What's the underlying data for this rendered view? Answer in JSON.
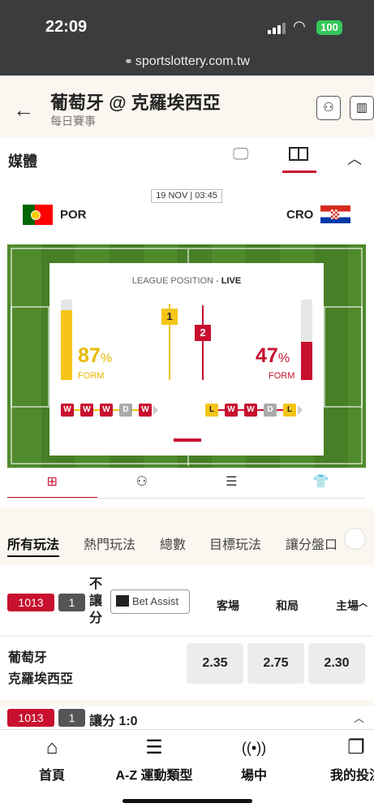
{
  "status": {
    "time": "22:09",
    "battery": "100"
  },
  "browser": {
    "url": "sportslottery.com.tw"
  },
  "header": {
    "title": "葡萄牙 @ 克羅埃西亞",
    "subtitle": "每日賽事"
  },
  "media": {
    "label": "媒體"
  },
  "match": {
    "datetime": "19 NOV | 03:45",
    "home": {
      "code": "POR"
    },
    "away": {
      "code": "CRO"
    }
  },
  "stats": {
    "league_position_label": "LEAGUE POSITION - ",
    "live_label": "LIVE",
    "home": {
      "form_pct": "87",
      "form_value": 0.87,
      "position": "1",
      "color": "#f5c518",
      "form": [
        "W",
        "W",
        "W",
        "D",
        "W"
      ]
    },
    "away": {
      "form_pct": "47",
      "form_value": 0.47,
      "position": "2",
      "color": "#c8102e",
      "form": [
        "L",
        "W",
        "W",
        "D",
        "L"
      ]
    },
    "pct_symbol": "%",
    "form_label": "FORM",
    "carousel_pages": 7,
    "carousel_active": 4
  },
  "icon_tabs": [
    {
      "name": "pitch-icon",
      "glyph": "⊞"
    },
    {
      "name": "lineup-icon",
      "glyph": "⚇"
    },
    {
      "name": "list-icon",
      "glyph": "☰"
    },
    {
      "name": "shirt-icon",
      "glyph": "👕"
    }
  ],
  "market_tabs": [
    "所有玩法",
    "熱門玩法",
    "總數",
    "目標玩法",
    "讓分盤口"
  ],
  "market1": {
    "id": "1013",
    "num": "1",
    "type_label": "不讓分",
    "bet_assist": "Bet Assist",
    "columns": [
      "客場",
      "和局",
      "主場"
    ],
    "teams": [
      "葡萄牙",
      "克羅埃西亞"
    ],
    "odds": [
      "2.35",
      "2.75",
      "2.30"
    ]
  },
  "market2": {
    "id": "1013",
    "num": "1",
    "label": "讓分 1:0"
  },
  "bottom_nav": [
    "首頁",
    "A-Z 運動類型",
    "場中",
    "我的投注"
  ]
}
